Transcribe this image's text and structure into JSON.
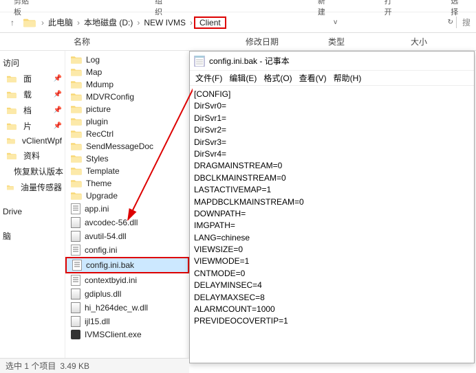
{
  "toolbar": {
    "t1": "剪贴板",
    "t2": "组织",
    "t3": "新建",
    "t4": "打开",
    "t5": "选择"
  },
  "breadcrumb": {
    "items": [
      "此电脑",
      "本地磁盘 (D:)",
      "NEW IVMS",
      "Client"
    ],
    "search_hint": "搜"
  },
  "columns": {
    "name": "名称",
    "date": "修改日期",
    "type": "类型",
    "size": "大小"
  },
  "sidebar": {
    "items": [
      {
        "label": "访问"
      },
      {
        "label": "面",
        "pin": true
      },
      {
        "label": "载",
        "pin": true
      },
      {
        "label": "档",
        "pin": true
      },
      {
        "label": "片",
        "pin": true
      },
      {
        "label": "vClientWpf"
      },
      {
        "label": "资料"
      },
      {
        "label": "恢复默认版本"
      },
      {
        "label": "油量传感器"
      }
    ],
    "drive": "Drive",
    "pc_label": "脑"
  },
  "files": [
    {
      "name": "Log",
      "type": "folder"
    },
    {
      "name": "Map",
      "type": "folder"
    },
    {
      "name": "Mdump",
      "type": "folder"
    },
    {
      "name": "MDVRConfig",
      "type": "folder"
    },
    {
      "name": "picture",
      "type": "folder"
    },
    {
      "name": "plugin",
      "type": "folder"
    },
    {
      "name": "RecCtrl",
      "type": "folder"
    },
    {
      "name": "SendMessageDoc",
      "type": "folder"
    },
    {
      "name": "Styles",
      "type": "folder"
    },
    {
      "name": "Template",
      "type": "folder"
    },
    {
      "name": "Theme",
      "type": "folder"
    },
    {
      "name": "Upgrade",
      "type": "folder"
    },
    {
      "name": "app.ini",
      "type": "ini"
    },
    {
      "name": "avcodec-56.dll",
      "type": "dll"
    },
    {
      "name": "avutil-54.dll",
      "type": "dll"
    },
    {
      "name": "config.ini",
      "type": "ini"
    },
    {
      "name": "config.ini.bak",
      "type": "ini",
      "selected": true,
      "boxed": true
    },
    {
      "name": "contextbyid.ini",
      "type": "ini"
    },
    {
      "name": "gdiplus.dll",
      "type": "dll"
    },
    {
      "name": "hi_h264dec_w.dll",
      "type": "dll"
    },
    {
      "name": "ijl15.dll",
      "type": "dll"
    },
    {
      "name": "IVMSClient.exe",
      "type": "exe"
    }
  ],
  "status": {
    "text": "选中 1 个项目",
    "size": "3.49 KB"
  },
  "notepad": {
    "title": "config.ini.bak - 记事本",
    "menus": [
      "文件(F)",
      "编辑(E)",
      "格式(O)",
      "查看(V)",
      "帮助(H)"
    ],
    "lines": [
      "[CONFIG]",
      "DirSvr0=",
      "DirSvr1=",
      "DirSvr2=",
      "DirSvr3=",
      "DirSvr4=",
      "DRAGMAINSTREAM=0",
      "DBCLKMAINSTREAM=0",
      "LASTACTIVEMAP=1",
      "MAPDBCLKMAINSTREAM=0",
      "DOWNPATH=",
      "IMGPATH=",
      "LANG=chinese",
      "VIEWSIZE=0",
      "VIEWMODE=1",
      "CNTMODE=0",
      "DELAYMINSEC=4",
      "DELAYMAXSEC=8",
      "ALARMCOUNT=1000",
      "PREVIDEOCOVERTIP=1"
    ]
  }
}
